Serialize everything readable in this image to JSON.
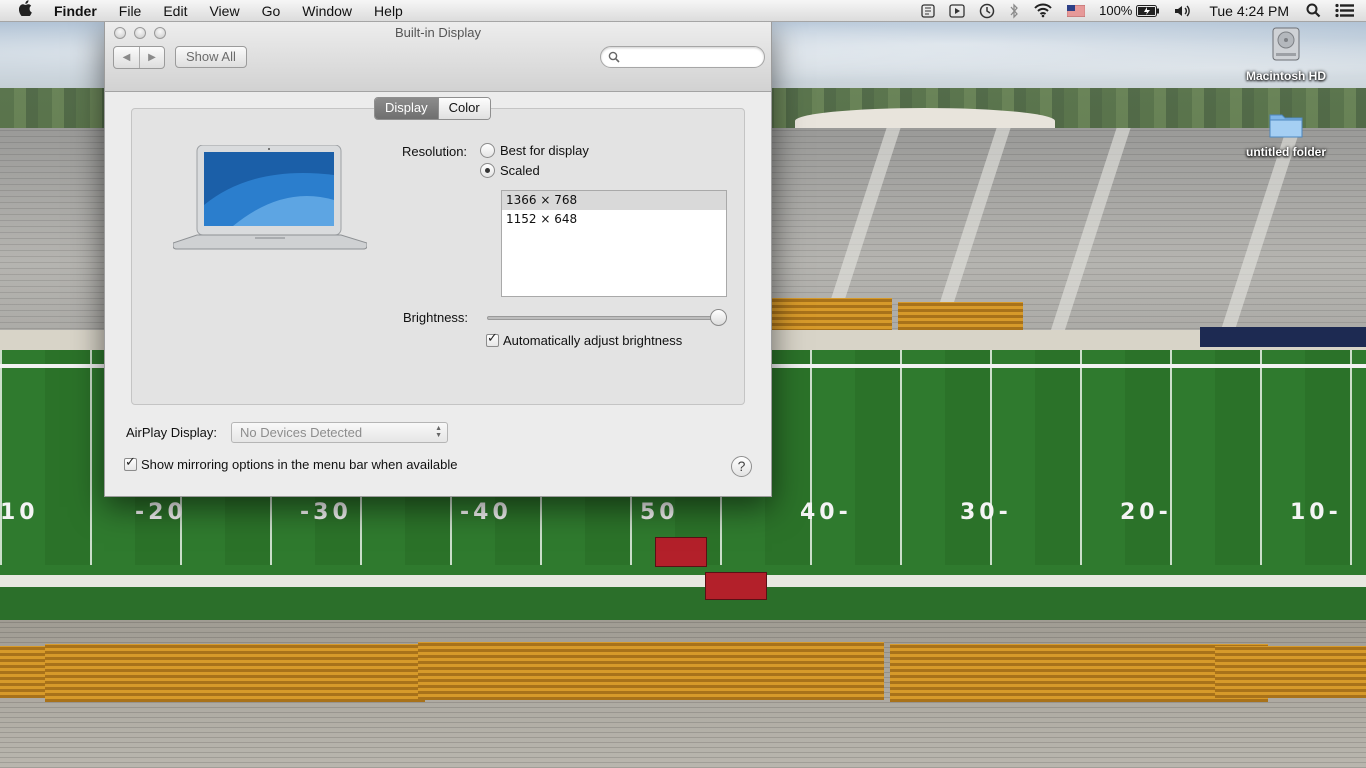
{
  "menubar": {
    "app_name": "Finder",
    "menus": [
      "File",
      "Edit",
      "View",
      "Go",
      "Window",
      "Help"
    ],
    "battery": "100%",
    "clock": "Tue 4:24 PM"
  },
  "desktop": {
    "icons": [
      {
        "label": "Macintosh HD",
        "icon": "hard-drive-icon"
      },
      {
        "label": "untitled folder",
        "icon": "folder-icon"
      }
    ]
  },
  "window": {
    "title": "Built-in Display",
    "show_all": "Show All",
    "search_placeholder": "",
    "tabs": [
      "Display",
      "Color"
    ],
    "active_tab": "Display",
    "resolution_label": "Resolution:",
    "resolution_options": [
      {
        "label": "Best for display",
        "selected": false
      },
      {
        "label": "Scaled",
        "selected": true
      }
    ],
    "scaled_list": [
      "1366 × 768",
      "1152 × 648"
    ],
    "selected_resolution": "1366 × 768",
    "brightness_label": "Brightness:",
    "brightness_level": 1.0,
    "auto_brightness_label": "Automatically adjust brightness",
    "auto_brightness_checked": true,
    "airplay_label": "AirPlay Display:",
    "airplay_value": "No Devices Detected",
    "mirroring_label": "Show mirroring options in the menu bar when available",
    "mirroring_checked": true,
    "help": "?"
  },
  "colors": {
    "tab_active": "#7d7d7d",
    "window_bg": "#ececec"
  }
}
